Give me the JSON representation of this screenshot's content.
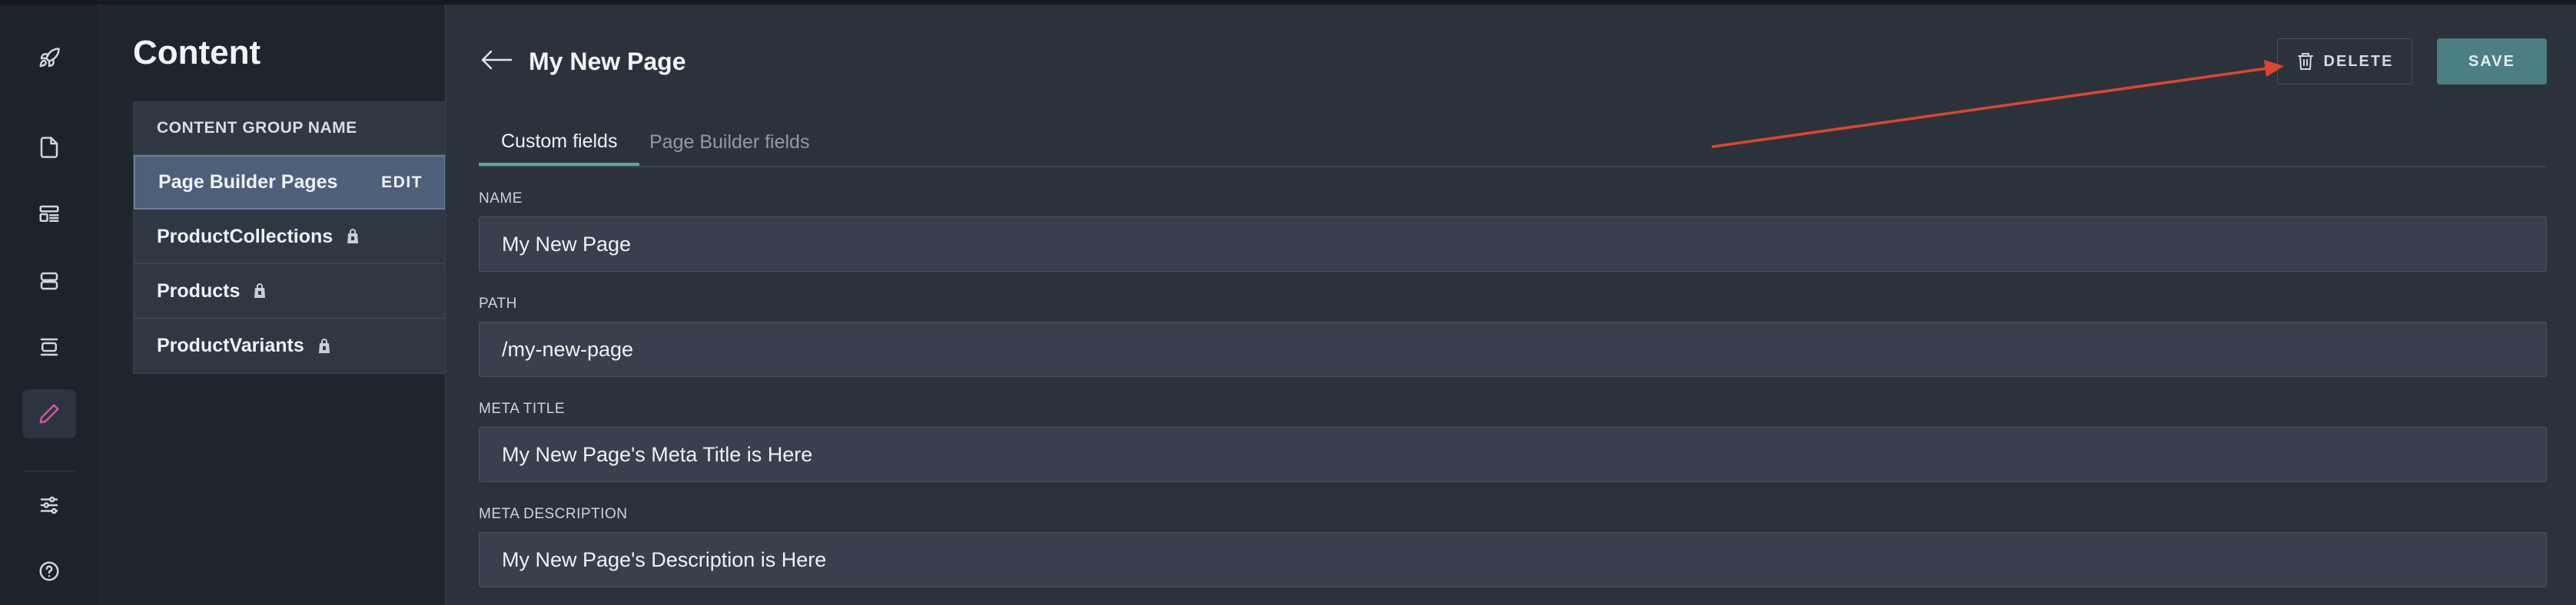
{
  "rail": {
    "items": [
      {
        "icon": "rocket-icon"
      },
      {
        "icon": "document-icon"
      },
      {
        "icon": "content-list-icon"
      },
      {
        "icon": "stack-icon"
      },
      {
        "icon": "layout-icon"
      },
      {
        "icon": "pencil-icon",
        "active": true
      },
      {
        "icon": "settings-sliders-icon"
      },
      {
        "icon": "help-icon"
      }
    ]
  },
  "groups": {
    "title": "Content",
    "header": "CONTENT GROUP NAME",
    "items": [
      {
        "label": "Page Builder Pages",
        "action": "EDIT",
        "selected": true
      },
      {
        "label": "ProductCollections",
        "locked": true
      },
      {
        "label": "Products",
        "locked": true
      },
      {
        "label": "ProductVariants",
        "locked": true
      }
    ]
  },
  "page": {
    "title": "My New Page",
    "delete_label": "DELETE",
    "save_label": "SAVE",
    "tabs": [
      {
        "label": "Custom fields",
        "active": true
      },
      {
        "label": "Page Builder fields",
        "active": false
      }
    ],
    "fields": [
      {
        "label": "NAME",
        "value": "My New Page"
      },
      {
        "label": "PATH",
        "value": "/my-new-page"
      },
      {
        "label": "META TITLE",
        "value": "My New Page's Meta Title is Here"
      },
      {
        "label": "META DESCRIPTION",
        "value": "My New Page's Description is Here"
      }
    ]
  },
  "colors": {
    "accent_save": "#4c7f83",
    "active_tab_underline": "#5fa6a8",
    "active_rail_icon": "#d9559c",
    "annotation_arrow": "#e0452f"
  }
}
